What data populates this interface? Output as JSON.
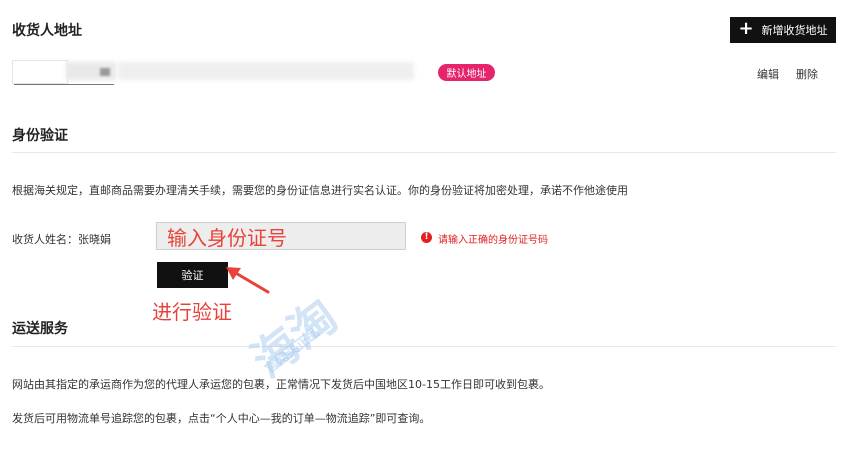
{
  "address_section": {
    "title": "收货人地址",
    "add_button_label": "新增收货地址",
    "default_badge": "默认地址",
    "edit_label": "编辑",
    "delete_label": "删除"
  },
  "identity_section": {
    "title": "身份验证",
    "notice": "根据海关规定，直邮商品需要办理清关手续，需要您的身份证信息进行实名认证。你的身份验证将加密处理，承诺不作他途使用",
    "name_label": "收货人姓名：张晓娟",
    "id_input_value": "输入身份证号",
    "error_message": "请输入正确的身份证号码",
    "verify_button_label": "验证",
    "annotation": "进行验证"
  },
  "shipping_section": {
    "title": "运送服务",
    "para1": "网站由其指定的承运商作为您的代理人承运您的包裹，正常情况下发货后中国地区10-15工作日即可收到包裹。",
    "para2": "发货后可用物流单号追踪您的包裹，点击“个人中心—我的订单—物流追踪”即可查询。"
  },
  "watermark": {
    "main": "海淘",
    "sub": "官网买正品"
  },
  "colors": {
    "accent_pink": "#e6246b",
    "annotation_red": "#e8433a",
    "error_red": "#e32020",
    "button_black": "#111111"
  },
  "icons": {
    "add": "plus-icon",
    "error": "exclamation-circle-icon",
    "pointer": "red-arrow-icon"
  }
}
